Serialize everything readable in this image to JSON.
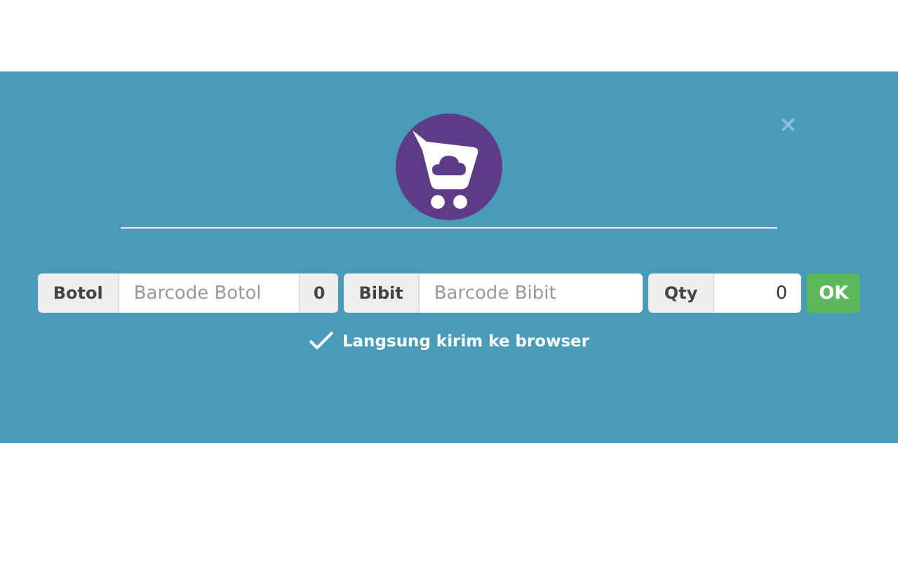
{
  "close": "×",
  "fields": [
    {
      "label": "Botol",
      "placeholder": "Barcode Botol",
      "suffix": "0"
    },
    {
      "label": "Bibit",
      "placeholder": "Barcode Bibit"
    },
    {
      "label": "Qty",
      "value": "0"
    }
  ],
  "ok_button": "OK",
  "option": {
    "label": "Langsung kirim ke browser",
    "checked": true
  }
}
